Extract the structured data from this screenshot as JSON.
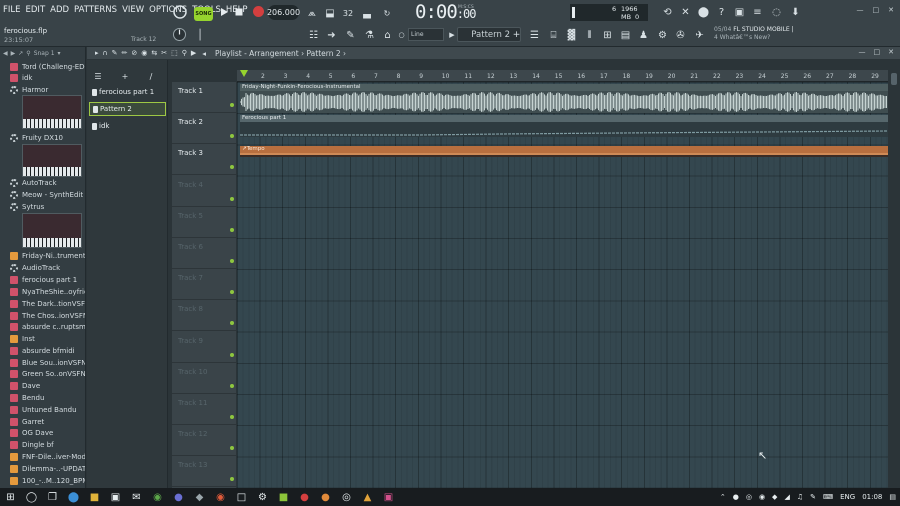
{
  "menu": [
    "FILE",
    "EDIT",
    "ADD",
    "PATTERNS",
    "VIEW",
    "OPTIONS",
    "TOOLS",
    "HELP"
  ],
  "project": {
    "name": "ferocious.flp",
    "time": "23:15:07",
    "hint": "Track 12"
  },
  "transport": {
    "mode_label": "SONG",
    "tempo": "206.000",
    "time": "0:00",
    "time_small": ":00",
    "time_unit": "M:S:CS"
  },
  "cpu": {
    "count": "6",
    "memory": "1966 MB",
    "zero": "0"
  },
  "snap_mode": "Line",
  "pattern_selector": "Pattern 2",
  "news": {
    "date": "05/04",
    "title": "FL STUDIO MOBILE |",
    "subtitle": "4 Whatâ€™s New?"
  },
  "browser": {
    "snap": "Snap 1",
    "items": [
      {
        "label": "Tord (Challeng-EDO)",
        "icon": "plugin-icon",
        "color": "#d0526a"
      },
      {
        "label": "idk",
        "icon": "plugin-icon",
        "color": "#d0526a"
      },
      {
        "label": "Harmor",
        "icon": "gear-icon",
        "color": "#c8d1d5"
      },
      {
        "label": "Fruity DX10",
        "icon": "gear-icon",
        "color": "#c8d1d5"
      },
      {
        "label": "AutoTrack",
        "icon": "gear-icon",
        "color": "#c8d1d5"
      },
      {
        "label": "Meow - SynthEdit",
        "icon": "gear-icon",
        "color": "#c8d1d5"
      },
      {
        "label": "Sytrus",
        "icon": "gear-icon",
        "color": "#c8d1d5"
      },
      {
        "label": "Friday-Ni..trumental",
        "icon": "audio-icon",
        "color": "#e59a3d"
      },
      {
        "label": "AudioTrack",
        "icon": "gear-icon",
        "color": "#c8d1d5"
      },
      {
        "label": "ferocious part 1",
        "icon": "plugin-icon",
        "color": "#d0526a"
      },
      {
        "label": "NyaTheShie..oyfriend",
        "icon": "plugin-icon",
        "color": "#d0526a"
      },
      {
        "label": "The Dark..tionVSFNF)",
        "icon": "plugin-icon",
        "color": "#d0526a"
      },
      {
        "label": "The Chos..ionVSFNF)",
        "icon": "plugin-icon",
        "color": "#d0526a"
      },
      {
        "label": "absurde c..ruptsmidi",
        "icon": "plugin-icon",
        "color": "#d0526a"
      },
      {
        "label": "Inst",
        "icon": "audio-icon",
        "color": "#e59a3d"
      },
      {
        "label": "absurde bfmidi",
        "icon": "plugin-icon",
        "color": "#d0526a"
      },
      {
        "label": "Blue Sou..ionVSFNF)",
        "icon": "plugin-icon",
        "color": "#d0526a"
      },
      {
        "label": "Green So..onVSFNF)",
        "icon": "plugin-icon",
        "color": "#d0526a"
      },
      {
        "label": "Dave",
        "icon": "plugin-icon",
        "color": "#d0526a"
      },
      {
        "label": "Bendu",
        "icon": "plugin-icon",
        "color": "#d0526a"
      },
      {
        "label": "Untuned Bandu",
        "icon": "plugin-icon",
        "color": "#d0526a"
      },
      {
        "label": "Garret",
        "icon": "plugin-icon",
        "color": "#d0526a"
      },
      {
        "label": "OG Dave",
        "icon": "plugin-icon",
        "color": "#d0526a"
      },
      {
        "label": "Dingle bf",
        "icon": "plugin-icon",
        "color": "#d0526a"
      },
      {
        "label": "FNF-Dile..iver-Mod_",
        "icon": "audio-icon",
        "color": "#e59a3d"
      },
      {
        "label": "Dilemma-..-UPDATE_",
        "icon": "audio-icon",
        "color": "#e59a3d"
      },
      {
        "label": "100_-..M..120_BPM",
        "icon": "audio-icon",
        "color": "#e59a3d"
      }
    ]
  },
  "patterns": [
    "ferocious part 1",
    "Pattern 2",
    "idk"
  ],
  "selected_pattern": 1,
  "playlist": {
    "title": "Playlist - Arrangement",
    "crumb": "Pattern 2",
    "bars": [
      2,
      3,
      4,
      5,
      6,
      7,
      8,
      9,
      10,
      11,
      12,
      13,
      14,
      15,
      16,
      17,
      18,
      19,
      20,
      21,
      22,
      23,
      24,
      25,
      26,
      27,
      28,
      29
    ],
    "tracks": [
      {
        "name": "Track 1",
        "active": true
      },
      {
        "name": "Track 2",
        "active": true
      },
      {
        "name": "Track 3",
        "active": true
      },
      {
        "name": "Track 4",
        "active": false
      },
      {
        "name": "Track 5",
        "active": false
      },
      {
        "name": "Track 6",
        "active": false
      },
      {
        "name": "Track 7",
        "active": false
      },
      {
        "name": "Track 8",
        "active": false
      },
      {
        "name": "Track 9",
        "active": false
      },
      {
        "name": "Track 10",
        "active": false
      },
      {
        "name": "Track 11",
        "active": false
      },
      {
        "name": "Track 12",
        "active": false
      },
      {
        "name": "Track 13",
        "active": false
      }
    ],
    "clips": {
      "audio": "Friday-Night-Funkin-Ferocious-Instrumental",
      "pattern": "Ferocious part 1",
      "automation": "Tempo"
    }
  },
  "taskbar": {
    "language": "ENG",
    "clock": "01:08"
  }
}
